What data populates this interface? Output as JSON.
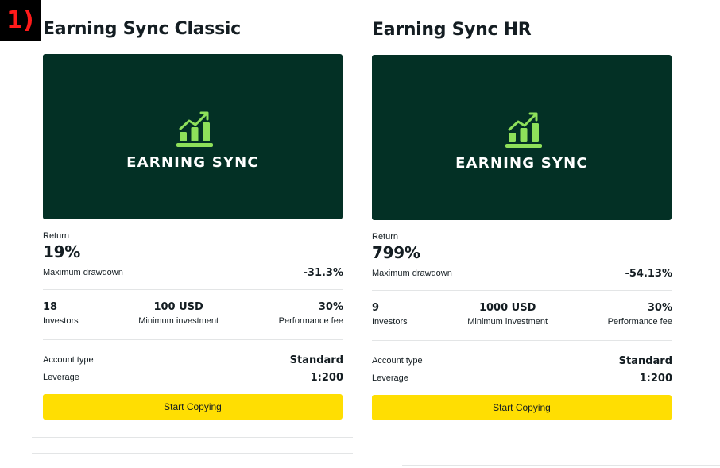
{
  "step_label": "1)",
  "cards": [
    {
      "title": "Earning Sync Classic",
      "banner_text": "EARNING SYNC",
      "banner_icon": "chart-growth-icon",
      "return_label": "Return",
      "return_value": "19%",
      "drawdown_label": "Maximum drawdown",
      "drawdown_value": "-31.3%",
      "investors_value": "18",
      "investors_label": "Investors",
      "min_investment_value": "100 USD",
      "min_investment_label": "Minimum investment",
      "performance_fee_value": "30%",
      "performance_fee_label": "Performance fee",
      "account_type_label": "Account type",
      "account_type_value": "Standard",
      "leverage_label": "Leverage",
      "leverage_value": "1:200",
      "button_label": "Start Copying"
    },
    {
      "title": "Earning Sync HR",
      "banner_text": "EARNING SYNC",
      "banner_icon": "chart-growth-icon",
      "return_label": "Return",
      "return_value": "799%",
      "drawdown_label": "Maximum drawdown",
      "drawdown_value": "-54.13%",
      "investors_value": "9",
      "investors_label": "Investors",
      "min_investment_value": "1000 USD",
      "min_investment_label": "Minimum investment",
      "performance_fee_value": "30%",
      "performance_fee_label": "Performance fee",
      "account_type_label": "Account type",
      "account_type_value": "Standard",
      "leverage_label": "Leverage",
      "leverage_value": "1:200",
      "button_label": "Start Copying"
    }
  ],
  "colors": {
    "banner_bg": "#033025",
    "icon_green": "#8ee05a",
    "button_yellow": "#ffde02",
    "step_badge_text": "#ff1a1a"
  }
}
